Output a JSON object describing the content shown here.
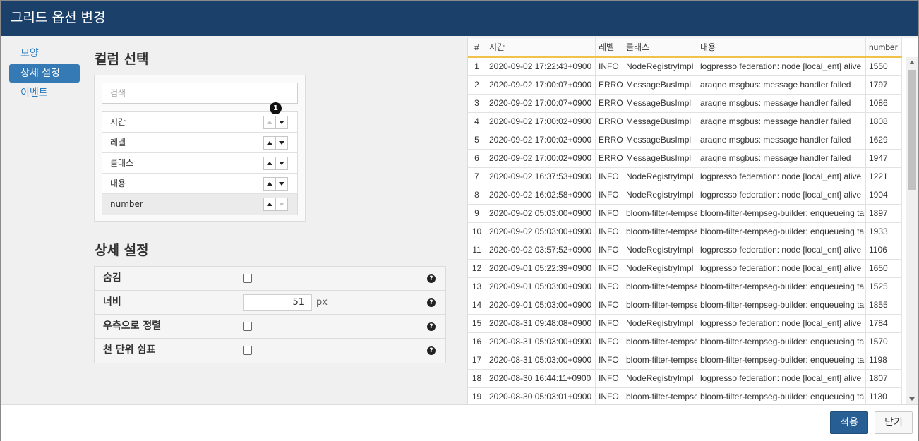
{
  "title": "그리드 옵션 변경",
  "nav": {
    "items": [
      {
        "label": "모양"
      },
      {
        "label": "상세 설정"
      },
      {
        "label": "이벤트"
      }
    ]
  },
  "column_select": {
    "heading": "컬럼 선택",
    "search_placeholder": "검색",
    "badge": "1",
    "columns": [
      {
        "label": "시간"
      },
      {
        "label": "레벨"
      },
      {
        "label": "클래스"
      },
      {
        "label": "내용"
      },
      {
        "label": "number"
      }
    ]
  },
  "detail": {
    "heading": "상세 설정",
    "hidden_label": "숨김",
    "width_label": "너비",
    "width_value": "51",
    "width_unit": "px",
    "align_right_label": "우측으로 정렬",
    "thousands_label": "천 단위 쉼표",
    "help_glyph": "?"
  },
  "grid": {
    "headers": [
      "#",
      "시간",
      "레벨",
      "클래스",
      "내용",
      "number"
    ],
    "rows": [
      [
        "1",
        "2020-09-02 17:22:43+0900",
        "INFO",
        "NodeRegistryImpl",
        "logpresso federation: node [local_ent] alive",
        "1550"
      ],
      [
        "2",
        "2020-09-02 17:00:07+0900",
        "ERROR",
        "MessageBusImpl",
        "araqne msgbus: message handler failed",
        "1797"
      ],
      [
        "3",
        "2020-09-02 17:00:07+0900",
        "ERROR",
        "MessageBusImpl",
        "araqne msgbus: message handler failed",
        "1086"
      ],
      [
        "4",
        "2020-09-02 17:00:02+0900",
        "ERROR",
        "MessageBusImpl",
        "araqne msgbus: message handler failed",
        "1808"
      ],
      [
        "5",
        "2020-09-02 17:00:02+0900",
        "ERROR",
        "MessageBusImpl",
        "araqne msgbus: message handler failed",
        "1629"
      ],
      [
        "6",
        "2020-09-02 17:00:02+0900",
        "ERROR",
        "MessageBusImpl",
        "araqne msgbus: message handler failed",
        "1947"
      ],
      [
        "7",
        "2020-09-02 16:37:53+0900",
        "INFO",
        "NodeRegistryImpl",
        "logpresso federation: node [local_ent] alive",
        "1221"
      ],
      [
        "8",
        "2020-09-02 16:02:58+0900",
        "INFO",
        "NodeRegistryImpl",
        "logpresso federation: node [local_ent] alive",
        "1904"
      ],
      [
        "9",
        "2020-09-02 05:03:00+0900",
        "INFO",
        "bloom-filter-tempseg",
        "bloom-filter-tempseg-builder: enqueueing ta",
        "1897"
      ],
      [
        "10",
        "2020-09-02 05:03:00+0900",
        "INFO",
        "bloom-filter-tempseg",
        "bloom-filter-tempseg-builder: enqueueing ta",
        "1933"
      ],
      [
        "11",
        "2020-09-02 03:57:52+0900",
        "INFO",
        "NodeRegistryImpl",
        "logpresso federation: node [local_ent] alive",
        "1106"
      ],
      [
        "12",
        "2020-09-01 05:22:39+0900",
        "INFO",
        "NodeRegistryImpl",
        "logpresso federation: node [local_ent] alive",
        "1650"
      ],
      [
        "13",
        "2020-09-01 05:03:00+0900",
        "INFO",
        "bloom-filter-tempseg",
        "bloom-filter-tempseg-builder: enqueueing ta",
        "1525"
      ],
      [
        "14",
        "2020-09-01 05:03:00+0900",
        "INFO",
        "bloom-filter-tempseg",
        "bloom-filter-tempseg-builder: enqueueing ta",
        "1855"
      ],
      [
        "15",
        "2020-08-31 09:48:08+0900",
        "INFO",
        "NodeRegistryImpl",
        "logpresso federation: node [local_ent] alive",
        "1784"
      ],
      [
        "16",
        "2020-08-31 05:03:00+0900",
        "INFO",
        "bloom-filter-tempseg",
        "bloom-filter-tempseg-builder: enqueueing ta",
        "1570"
      ],
      [
        "17",
        "2020-08-31 05:03:00+0900",
        "INFO",
        "bloom-filter-tempseg",
        "bloom-filter-tempseg-builder: enqueueing ta",
        "1198"
      ],
      [
        "18",
        "2020-08-30 16:44:11+0900",
        "INFO",
        "NodeRegistryImpl",
        "logpresso federation: node [local_ent] alive",
        "1807"
      ],
      [
        "19",
        "2020-08-30 05:03:01+0900",
        "INFO",
        "bloom-filter-tempseg",
        "bloom-filter-tempseg-builder: enqueueing ta",
        "1130"
      ]
    ]
  },
  "footer": {
    "apply_label": "적용",
    "close_label": "닫기"
  },
  "colors": {
    "titlebar": "#1b416b",
    "accent": "#3579b5",
    "header_underline": "#f1c24a"
  }
}
